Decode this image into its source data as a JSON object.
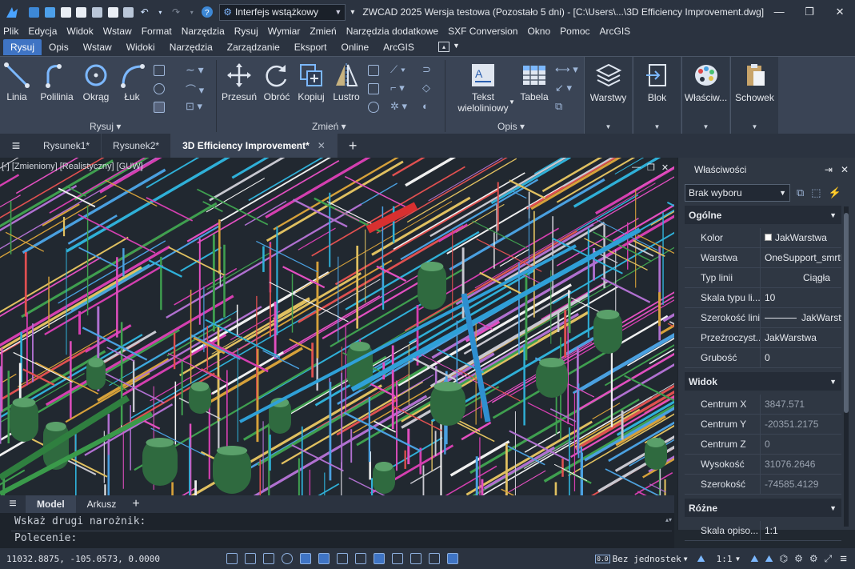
{
  "app": {
    "title": "ZWCAD 2025 Wersja testowa (Pozostało 5 dni) - [C:\\Users\\...\\3D Efficiency Improvement.dwg]",
    "workspace": "Interfejs wstążkowy"
  },
  "menu": [
    "Plik",
    "Edycja",
    "Widok",
    "Wstaw",
    "Format",
    "Narzędzia",
    "Rysuj",
    "Wymiar",
    "Zmień",
    "Narzędzia dodatkowe",
    "SXF Conversion",
    "Okno",
    "Pomoc",
    "ArcGIS"
  ],
  "ribbon_tabs": [
    {
      "label": "Rysuj",
      "active": true
    },
    {
      "label": "Opis"
    },
    {
      "label": "Wstaw"
    },
    {
      "label": "Widoki"
    },
    {
      "label": "Narzędzia"
    },
    {
      "label": "Zarządzanie"
    },
    {
      "label": "Eksport"
    },
    {
      "label": "Online"
    },
    {
      "label": "ArcGIS"
    }
  ],
  "ribbon": {
    "draw": {
      "linia": "Linia",
      "polilinia": "Polilinia",
      "okrag": "Okrąg",
      "luk": "Łuk",
      "group": "Rysuj ▾"
    },
    "modify": {
      "przesun": "Przesuń",
      "obroc": "Obróć",
      "kopiuj": "Kopiuj",
      "lustro": "Lustro",
      "group": "Zmień ▾"
    },
    "annotation": {
      "tekst1": "Tekst",
      "tekst2": "wieloliniowy",
      "tabela": "Tabela",
      "group": "Opis ▾"
    },
    "panels": {
      "warstwy": "Warstwy",
      "blok": "Blok",
      "wlasciwosci": "Właściw...",
      "schowek": "Schowek"
    }
  },
  "doc_tabs": [
    {
      "label": "Rysunek1*"
    },
    {
      "label": "Rysunek2*"
    },
    {
      "label": "3D Efficiency Improvement*",
      "active": true
    }
  ],
  "viewport": {
    "label": "[-] [Zmieniony] [Realistyczny] [GUW]"
  },
  "properties": {
    "title": "Właściwości",
    "selection": "Brak wyboru",
    "sections": {
      "general": "Ogólne",
      "view": "Widok",
      "misc": "Różne"
    },
    "general": [
      {
        "key": "Kolor",
        "value": "JakWarstwa"
      },
      {
        "key": "Warstwa",
        "value": "OneSupport_smrtIn"
      },
      {
        "key": "Typ linii",
        "value": "Ciągła"
      },
      {
        "key": "Skala typu li...",
        "value": "10"
      },
      {
        "key": "Szerokość linii",
        "value": "JakWarstwa"
      },
      {
        "key": "Przeźroczyst...",
        "value": "JakWarstwa"
      },
      {
        "key": "Grubość",
        "value": "0"
      }
    ],
    "view": [
      {
        "key": "Centrum X",
        "value": "3847.571"
      },
      {
        "key": "Centrum Y",
        "value": "-20351.2175"
      },
      {
        "key": "Centrum Z",
        "value": "0"
      },
      {
        "key": "Wysokość",
        "value": "31076.2646"
      },
      {
        "key": "Szerokość",
        "value": "-74585.4129"
      }
    ],
    "misc": [
      {
        "key": "Skala opiso...",
        "value": "1:1"
      }
    ]
  },
  "layout_tabs": [
    {
      "label": "Model",
      "active": true
    },
    {
      "label": "Arkusz"
    }
  ],
  "command": {
    "history": "Wskaż drugi narożnik:",
    "prompt": "Polecenie:"
  },
  "status": {
    "coords": "11032.8875, -105.0573, 0.0000",
    "units": "Bez jednostek",
    "scale": "1:1"
  },
  "colors": {
    "accent": "#3f74c4",
    "background": "#212830",
    "panel": "#2f3743"
  }
}
